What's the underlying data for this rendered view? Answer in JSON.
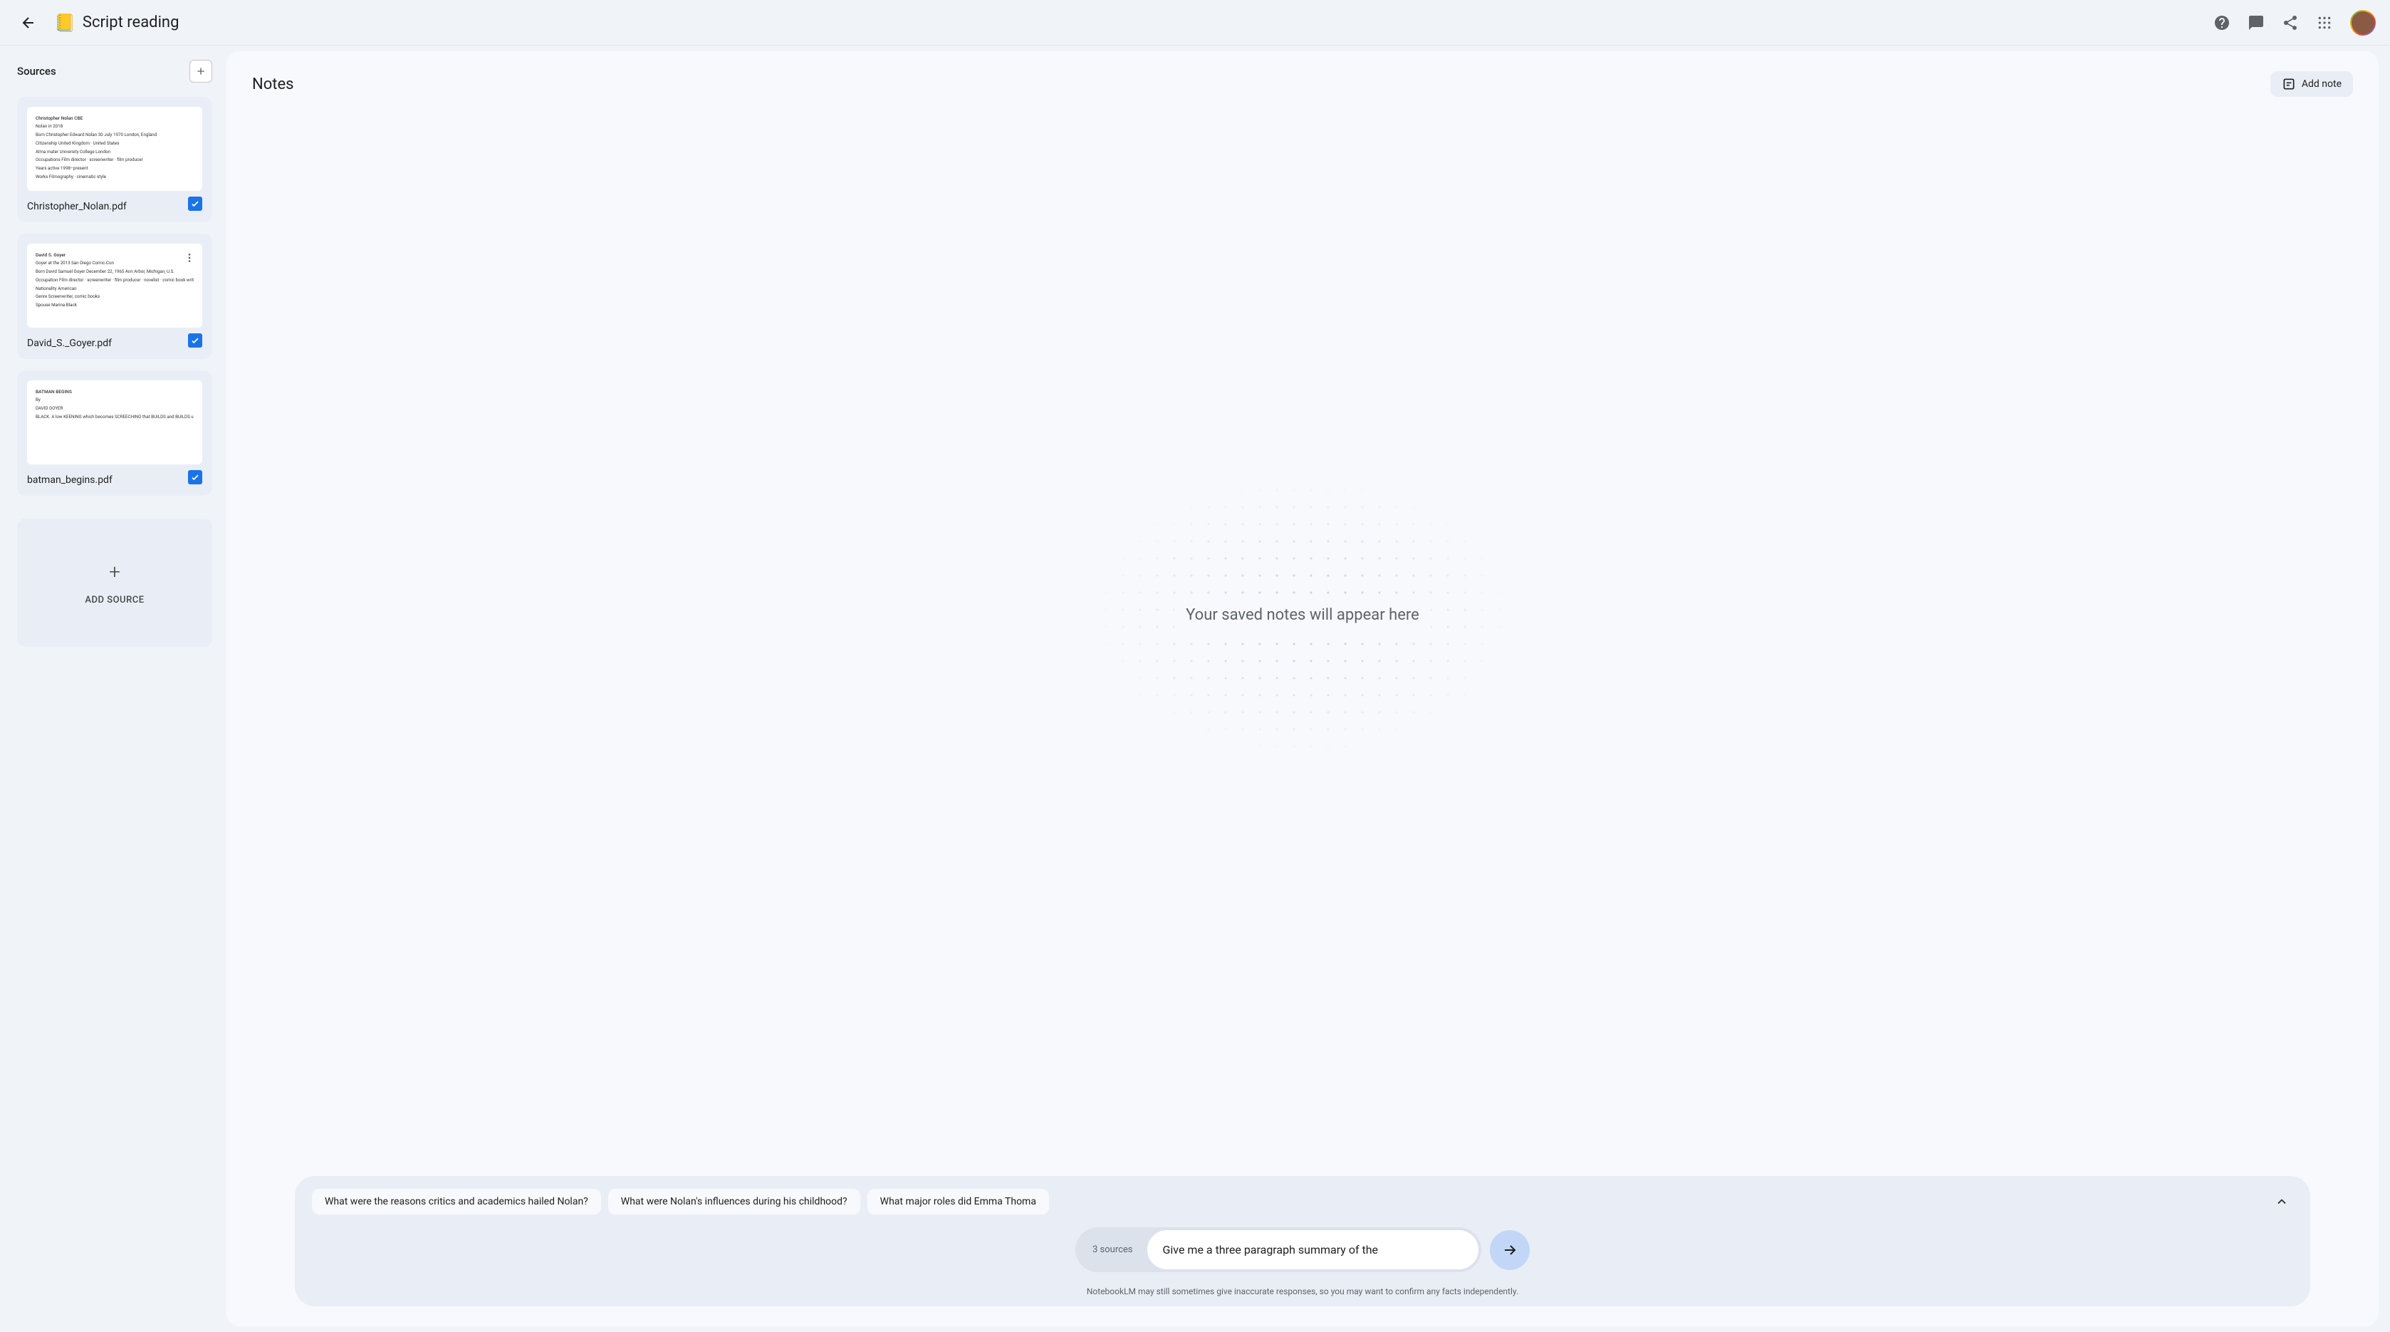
{
  "header": {
    "title_icon": "📒",
    "title": "Script reading"
  },
  "sidebar": {
    "title": "Sources",
    "add_source_label": "ADD SOURCE",
    "cards": [
      {
        "name": "Christopher_Nolan.pdf",
        "checked": true,
        "preview": [
          "Christopher Nolan CBE",
          "Nolan in 2018",
          "Born Christopher Edward Nolan 30 July 1970 London, England",
          "Citizenship United Kingdom · United States",
          "Alma mater University College London",
          "Occupations Film director · screenwriter · film producer",
          "Years active 1998–present",
          "Works Filmography · cinematic style"
        ]
      },
      {
        "name": "David_S._Goyer.pdf",
        "checked": true,
        "preview": [
          "David S. Goyer",
          "Goyer at the 2013 San Diego Comic-Con",
          "Born David Samuel Goyer December 22, 1965 Ann Arbor, Michigan, U.S.",
          "Occupation Film director · screenwriter · film producer · novelist · comic book writer",
          "Nationality American",
          "Genre Screenwriter, comic books",
          "Spouse Marina Black"
        ]
      },
      {
        "name": "batman_begins.pdf",
        "checked": true,
        "preview": [
          "BATMAN BEGINS",
          "By",
          "DAVID GOYER",
          "BLACK. A low KEENING which becomes SCREECHING that BUILDS and BUILDS until- RED flickers through black as the SCREECHING resolves into the cries of MILLIONS of BATS. Filled against a blood red sky, bolting away from camera, MASSING in the sky... FORMING a density the shape of an enormous BAT-LIKE SYMBOL. More BATS mass, swamping the symbol, DARKENING the screen to- BLACK. Distant children's LAUGHTER which COMES CLOSER, MORE INSISTENT until CUT TO: Sunlight through trees running through a SUMMER GARDEN. A"
        ]
      }
    ]
  },
  "notes": {
    "title": "Notes",
    "add_note_label": "Add note",
    "empty_text": "Your saved notes will appear here"
  },
  "chat": {
    "suggestions": [
      "What were the reasons critics and academics hailed Nolan?",
      "What were Nolan's influences during his childhood?",
      "What major roles did Emma Thoma"
    ],
    "sources_count": "3 sources",
    "input_value": "Give me a three paragraph summary of the",
    "disclaimer": "NotebookLM may still sometimes give inaccurate responses, so you may want to confirm any facts independently."
  }
}
